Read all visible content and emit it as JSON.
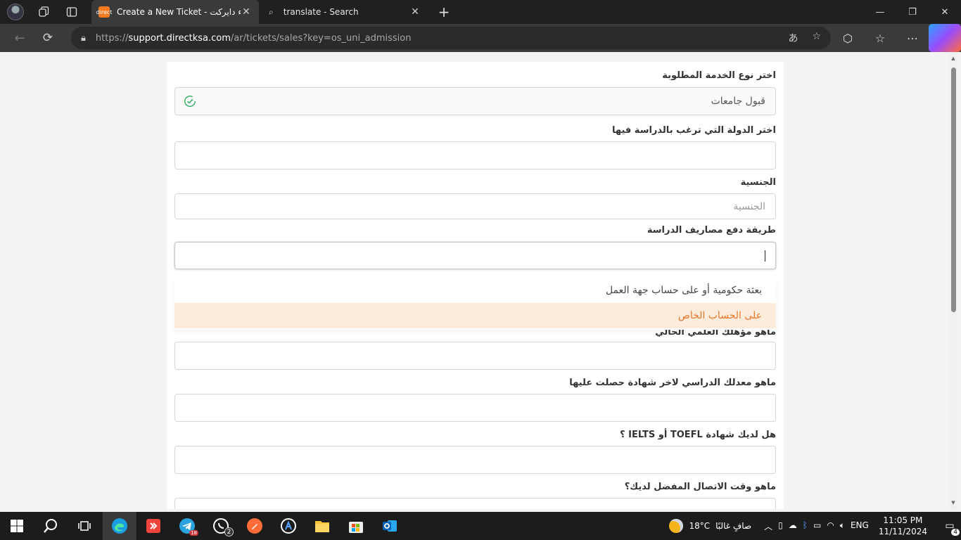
{
  "browser": {
    "tabs": [
      {
        "title": "Create a New Ticket - عملاء دايركت",
        "active": true
      },
      {
        "title": "translate - Search",
        "active": false
      }
    ],
    "url": {
      "scheme": "https://",
      "host": "support.directksa.com",
      "path": "/ar/tickets/sales?key=os_uni_admission"
    },
    "favicon_text": "direct"
  },
  "form": {
    "fields": [
      {
        "label": "اختر نوع الخدمة المطلوبة",
        "value": "قبول جامعات",
        "placeholder": "",
        "valid": true
      },
      {
        "label": "اختر الدولة التي ترغب بالدراسة فيها",
        "value": "",
        "placeholder": ""
      },
      {
        "label": "الجنسية",
        "value": "",
        "placeholder": "الجنسية"
      },
      {
        "label": "طريقة دفع مصاريف الدراسة",
        "value": "",
        "placeholder": "",
        "focused": true
      },
      {
        "label": "ماهو مؤهلك العلمي الحالي",
        "value": "",
        "placeholder": ""
      },
      {
        "label": "ماهو معدلك الدراسي لاخر شهادة حصلت عليها",
        "value": "",
        "placeholder": ""
      },
      {
        "label": "هل لديك شهادة TOEFL أو IELTS ؟",
        "value": "",
        "placeholder": ""
      },
      {
        "label": "ماهو وقت الاتصال المفضل لديك؟",
        "value": "",
        "placeholder": ""
      }
    ],
    "dropdown_options": [
      {
        "label": "بعثة حكومية أو على حساب جهة العمل",
        "highlighted": false
      },
      {
        "label": "على الحساب الخاص",
        "highlighted": true
      }
    ],
    "accent_color": "#e8782a",
    "valid_color": "#2eae63"
  },
  "taskbar": {
    "apps": [
      "windows-start",
      "search",
      "task-view",
      "edge",
      "anydesk",
      "telegram",
      "whatsapp",
      "postman",
      "app-a",
      "file-explorer",
      "microsoft-store",
      "outlook"
    ],
    "telegram_badge": "18",
    "whatsapp_badge": "2",
    "weather": {
      "temp": "18°C",
      "desc": "صافٍ غالبًا"
    },
    "language": "ENG",
    "time": "11:05 PM",
    "date": "11/11/2024",
    "notifications": "4"
  }
}
